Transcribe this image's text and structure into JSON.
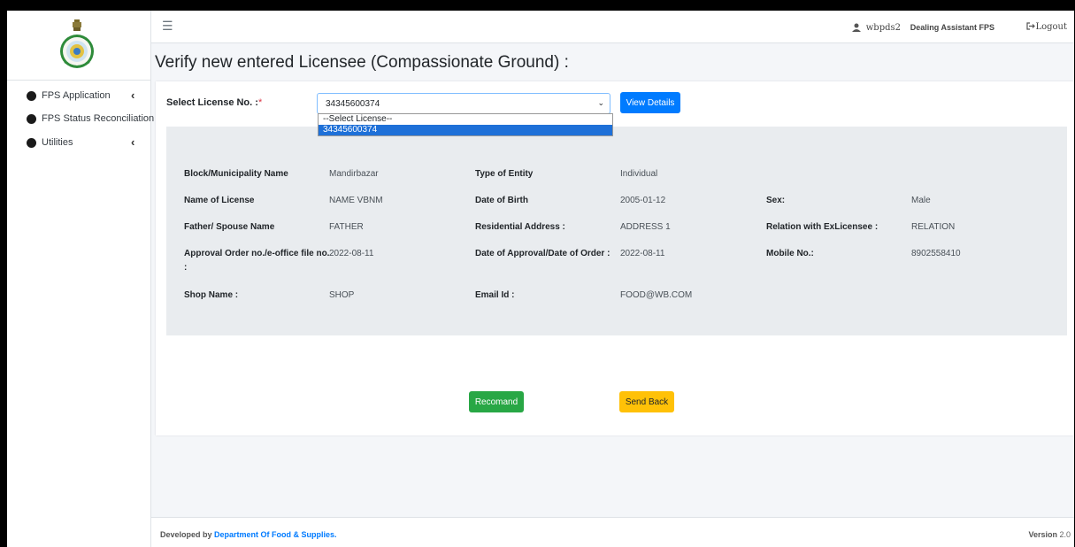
{
  "sidebar": {
    "items": [
      {
        "label": "FPS Application",
        "chevron": "‹"
      },
      {
        "label": "FPS Status Reconciliation"
      },
      {
        "label": "Utilities",
        "chevron": "‹"
      }
    ]
  },
  "header": {
    "menu_icon": "☰",
    "username": "wbpds2",
    "role": "Dealing Assistant FPS",
    "logout": "Logout"
  },
  "page": {
    "title": "Verify new entered Licensee (Compassionate Ground) :"
  },
  "form": {
    "select_label": "Select License No. :",
    "required_mark": "*",
    "selected_value": "34345600374",
    "options": [
      "--Select License--",
      "34345600374"
    ],
    "view_button": "View Details"
  },
  "details": {
    "block_label": "Block/Municipality Name",
    "block_value": "Mandirbazar",
    "entity_label": "Type of Entity",
    "entity_value": "Individual",
    "name_label": "Name of License",
    "name_value": "NAME VBNM",
    "dob_label": "Date of Birth",
    "dob_value": "2005-01-12",
    "sex_label": "Sex:",
    "sex_value": "Male",
    "father_label": "Father/ Spouse Name",
    "father_value": "FATHER",
    "address_label": "Residential Address :",
    "address_value": "ADDRESS 1",
    "relation_label": "Relation with ExLicensee :",
    "relation_value": "RELATION",
    "approval_label_1": "Approval Order no./e-office file no.",
    "approval_label_2": ":",
    "approval_value": "2022-08-11",
    "approval_date_label": "Date of Approval/Date of Order :",
    "approval_date_value": "2022-08-11",
    "mobile_label": "Mobile No.:",
    "mobile_value": "8902558410",
    "shop_label": "Shop Name :",
    "shop_value": "SHOP",
    "email_label": "Email Id :",
    "email_value": "FOOD@WB.COM"
  },
  "actions": {
    "recommend": "Recomand",
    "send_back": "Send Back"
  },
  "footer": {
    "prefix": "Developed by",
    "department": "Department Of Food & Supplies.",
    "version_label": "Version",
    "version_number": "2.0"
  }
}
